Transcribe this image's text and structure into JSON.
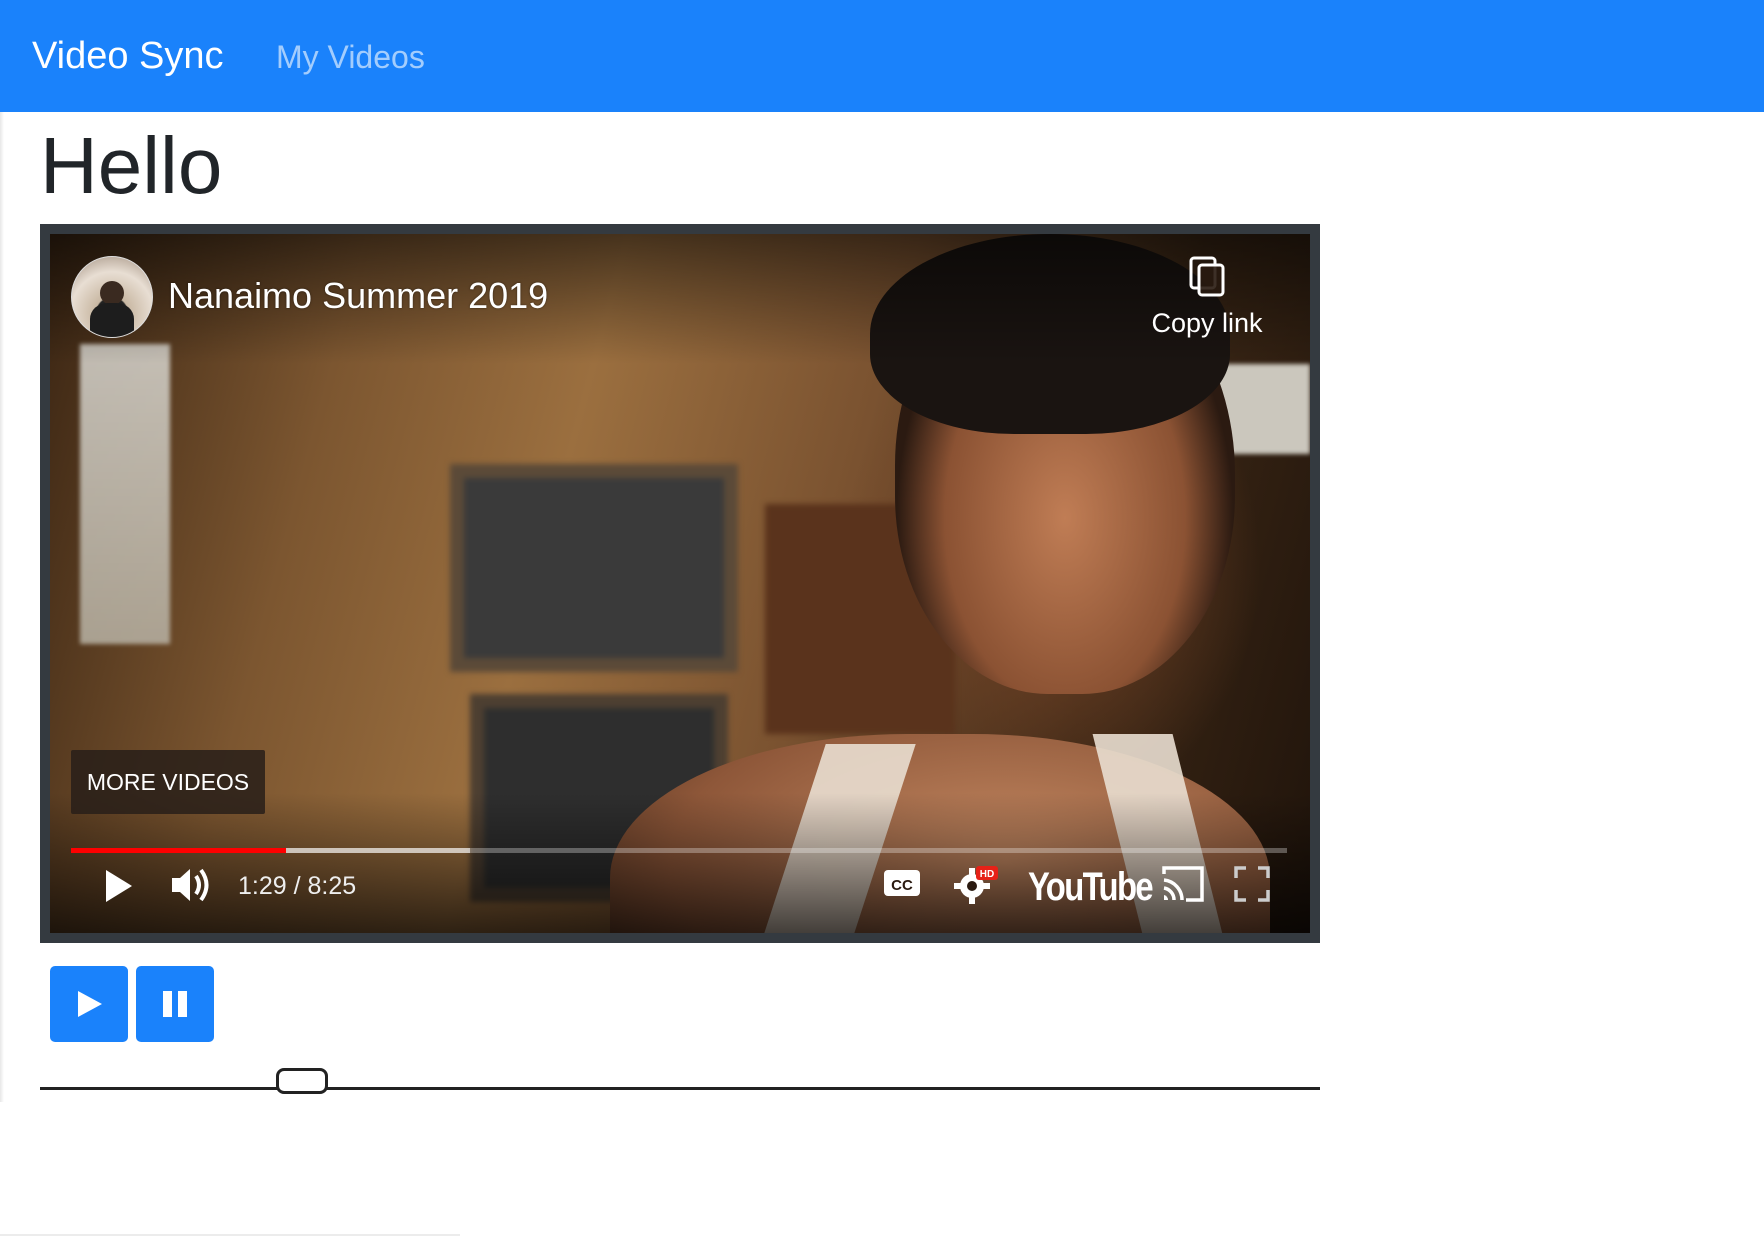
{
  "navbar": {
    "brand": "Video Sync",
    "link": "My Videos"
  },
  "page": {
    "title": "Hello"
  },
  "player": {
    "video_title": "Nanaimo Summer 2019",
    "copy_link_label": "Copy link",
    "more_videos_label": "MORE VIDEOS",
    "time_current": "1:29",
    "time_total": "8:25",
    "time_display": "1:29 / 8:25",
    "played_fraction": 0.177,
    "buffered_fraction": 0.328,
    "logo_text": "YouTube",
    "hd_badge": "HD",
    "cc_label": "CC",
    "icons": [
      "copy-icon",
      "play-icon",
      "volume-icon",
      "captions-icon",
      "settings-icon",
      "cast-icon",
      "fullscreen-icon"
    ],
    "colors": {
      "progress": "#ff0000",
      "border": "#343a40"
    }
  },
  "controls": {
    "play_icon": "play-icon",
    "pause_icon": "pause-icon",
    "button_color": "#1a82fb"
  },
  "seek_slider": {
    "value_fraction": 0.205
  }
}
